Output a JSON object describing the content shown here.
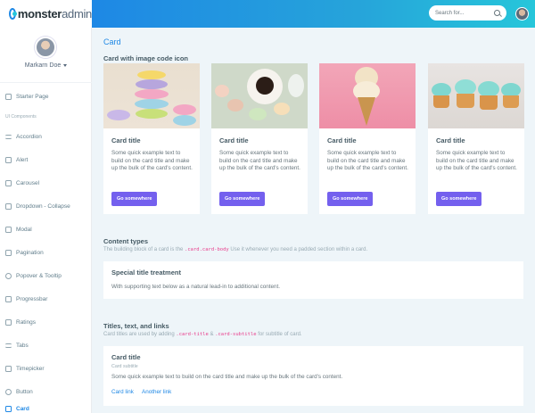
{
  "brand": {
    "name_bold": "monster",
    "name_light": "admin"
  },
  "search": {
    "placeholder": "Search for..."
  },
  "profile": {
    "name": "Markarn Doe"
  },
  "sidebar": {
    "items": [
      {
        "label": "Starter Page"
      },
      {
        "label": "Accordion"
      },
      {
        "label": "Alert"
      },
      {
        "label": "Carousel"
      },
      {
        "label": "Dropdown - Collapse"
      },
      {
        "label": "Modal"
      },
      {
        "label": "Pagination"
      },
      {
        "label": "Popover & Tooltip"
      },
      {
        "label": "Progressbar"
      },
      {
        "label": "Ratings"
      },
      {
        "label": "Tabs"
      },
      {
        "label": "Timepicker"
      },
      {
        "label": "Button"
      },
      {
        "label": "Card"
      }
    ],
    "section_label": "UI Components",
    "active": "Card"
  },
  "main": {
    "page_title": "Card",
    "image_cards_heading": "Card with image code icon",
    "cards": [
      {
        "title": "Card title",
        "text": "Some quick example text to build on the card title and make up the bulk of the card's content.",
        "button": "Go somewhere"
      },
      {
        "title": "Card title",
        "text": "Some quick example text to build on the card title and make up the bulk of the card's content.",
        "button": "Go somewhere"
      },
      {
        "title": "Card title",
        "text": "Some quick example text to build on the card title and make up the bulk of the card's content.",
        "button": "Go somewhere"
      },
      {
        "title": "Card title",
        "text": "Some quick example text to build on the card title and make up the bulk of the card's content.",
        "button": "Go somewhere"
      }
    ],
    "content_types": {
      "heading": "Content types",
      "sub_before": "The building block of a card is the",
      "sub_code": ".card.card-body",
      "sub_after": "Use it whenever you need a padded section within a card."
    },
    "special_card": {
      "title": "Special title treatment",
      "text": "With supporting text below as a natural lead-in to additional content."
    },
    "titles_section": {
      "heading": "Titles, text, and links",
      "sub_before": "Card titles are used by adding",
      "sub_code1": ".card-title",
      "sub_mid": "&",
      "sub_code2": ".card-subtitle",
      "sub_after": "for subtitle of card."
    },
    "titles_card": {
      "title": "Card title",
      "subtitle": "Card subtitle",
      "text": "Some quick example text to build on the card title and make up the bulk of the card's content.",
      "link1": "Card link",
      "link2": "Another link"
    }
  },
  "colors": {
    "accent": "#1e88e5",
    "button": "#7460ee",
    "code": "#e83e8c"
  }
}
